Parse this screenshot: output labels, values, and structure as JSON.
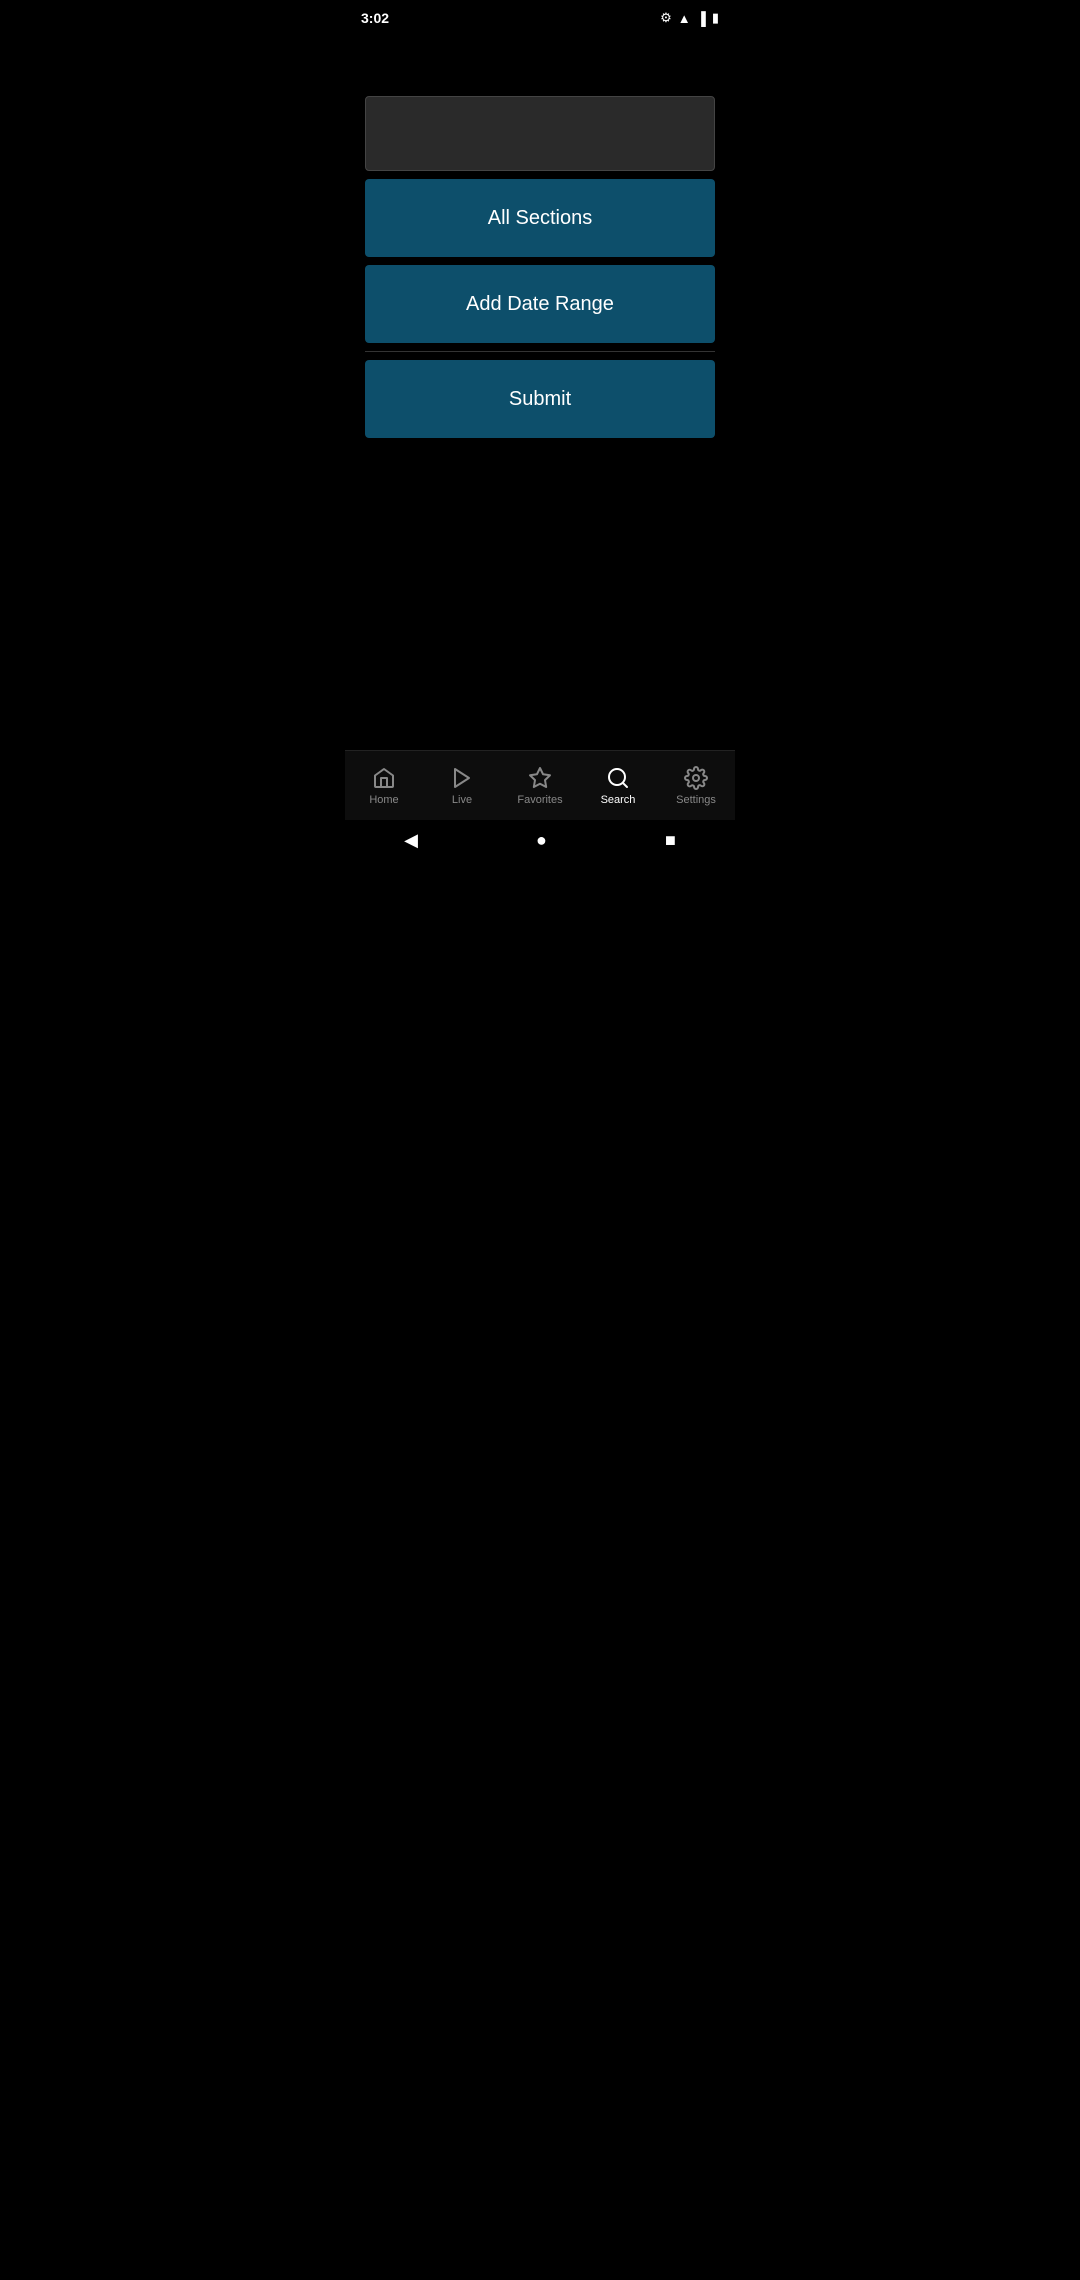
{
  "status_bar": {
    "time": "3:02",
    "settings_icon": "gear-icon",
    "wifi_icon": "wifi-icon",
    "signal_icon": "signal-icon",
    "battery_icon": "battery-icon"
  },
  "search_input": {
    "placeholder": "",
    "value": ""
  },
  "buttons": {
    "all_sections_label": "All Sections",
    "add_date_range_label": "Add Date Range",
    "submit_label": "Submit"
  },
  "bottom_nav": {
    "items": [
      {
        "id": "home",
        "label": "Home",
        "active": false
      },
      {
        "id": "live",
        "label": "Live",
        "active": false
      },
      {
        "id": "favorites",
        "label": "Favorites",
        "active": false
      },
      {
        "id": "search",
        "label": "Search",
        "active": true
      },
      {
        "id": "settings",
        "label": "Settings",
        "active": false
      }
    ]
  },
  "system_nav": {
    "back": "◀",
    "home": "●",
    "recents": "■"
  }
}
